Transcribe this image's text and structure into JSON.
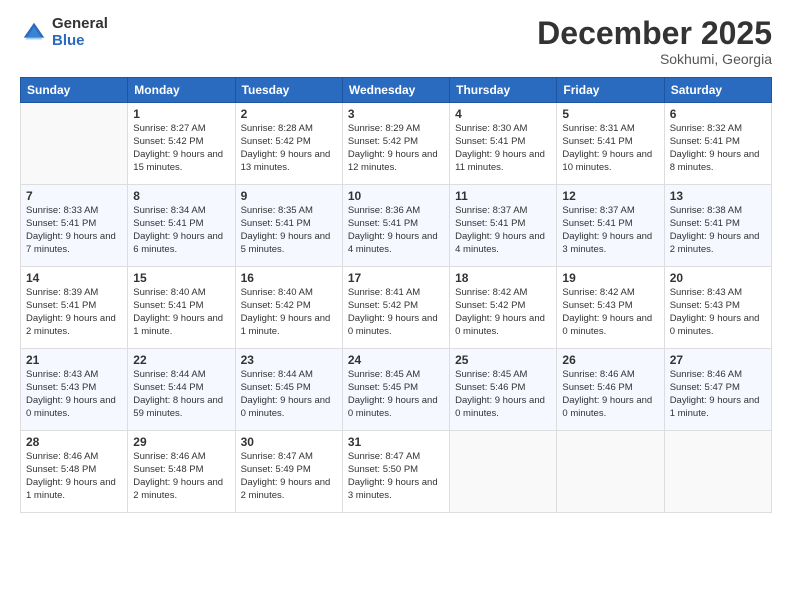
{
  "logo": {
    "general": "General",
    "blue": "Blue"
  },
  "title": "December 2025",
  "location": "Sokhumi, Georgia",
  "weekdays": [
    "Sunday",
    "Monday",
    "Tuesday",
    "Wednesday",
    "Thursday",
    "Friday",
    "Saturday"
  ],
  "weeks": [
    [
      {
        "day": "",
        "sunrise": "",
        "sunset": "",
        "daylight": "",
        "empty": true
      },
      {
        "day": "1",
        "sunrise": "Sunrise: 8:27 AM",
        "sunset": "Sunset: 5:42 PM",
        "daylight": "Daylight: 9 hours and 15 minutes."
      },
      {
        "day": "2",
        "sunrise": "Sunrise: 8:28 AM",
        "sunset": "Sunset: 5:42 PM",
        "daylight": "Daylight: 9 hours and 13 minutes."
      },
      {
        "day": "3",
        "sunrise": "Sunrise: 8:29 AM",
        "sunset": "Sunset: 5:42 PM",
        "daylight": "Daylight: 9 hours and 12 minutes."
      },
      {
        "day": "4",
        "sunrise": "Sunrise: 8:30 AM",
        "sunset": "Sunset: 5:41 PM",
        "daylight": "Daylight: 9 hours and 11 minutes."
      },
      {
        "day": "5",
        "sunrise": "Sunrise: 8:31 AM",
        "sunset": "Sunset: 5:41 PM",
        "daylight": "Daylight: 9 hours and 10 minutes."
      },
      {
        "day": "6",
        "sunrise": "Sunrise: 8:32 AM",
        "sunset": "Sunset: 5:41 PM",
        "daylight": "Daylight: 9 hours and 8 minutes."
      }
    ],
    [
      {
        "day": "7",
        "sunrise": "Sunrise: 8:33 AM",
        "sunset": "Sunset: 5:41 PM",
        "daylight": "Daylight: 9 hours and 7 minutes."
      },
      {
        "day": "8",
        "sunrise": "Sunrise: 8:34 AM",
        "sunset": "Sunset: 5:41 PM",
        "daylight": "Daylight: 9 hours and 6 minutes."
      },
      {
        "day": "9",
        "sunrise": "Sunrise: 8:35 AM",
        "sunset": "Sunset: 5:41 PM",
        "daylight": "Daylight: 9 hours and 5 minutes."
      },
      {
        "day": "10",
        "sunrise": "Sunrise: 8:36 AM",
        "sunset": "Sunset: 5:41 PM",
        "daylight": "Daylight: 9 hours and 4 minutes."
      },
      {
        "day": "11",
        "sunrise": "Sunrise: 8:37 AM",
        "sunset": "Sunset: 5:41 PM",
        "daylight": "Daylight: 9 hours and 4 minutes."
      },
      {
        "day": "12",
        "sunrise": "Sunrise: 8:37 AM",
        "sunset": "Sunset: 5:41 PM",
        "daylight": "Daylight: 9 hours and 3 minutes."
      },
      {
        "day": "13",
        "sunrise": "Sunrise: 8:38 AM",
        "sunset": "Sunset: 5:41 PM",
        "daylight": "Daylight: 9 hours and 2 minutes."
      }
    ],
    [
      {
        "day": "14",
        "sunrise": "Sunrise: 8:39 AM",
        "sunset": "Sunset: 5:41 PM",
        "daylight": "Daylight: 9 hours and 2 minutes."
      },
      {
        "day": "15",
        "sunrise": "Sunrise: 8:40 AM",
        "sunset": "Sunset: 5:41 PM",
        "daylight": "Daylight: 9 hours and 1 minute."
      },
      {
        "day": "16",
        "sunrise": "Sunrise: 8:40 AM",
        "sunset": "Sunset: 5:42 PM",
        "daylight": "Daylight: 9 hours and 1 minute."
      },
      {
        "day": "17",
        "sunrise": "Sunrise: 8:41 AM",
        "sunset": "Sunset: 5:42 PM",
        "daylight": "Daylight: 9 hours and 0 minutes."
      },
      {
        "day": "18",
        "sunrise": "Sunrise: 8:42 AM",
        "sunset": "Sunset: 5:42 PM",
        "daylight": "Daylight: 9 hours and 0 minutes."
      },
      {
        "day": "19",
        "sunrise": "Sunrise: 8:42 AM",
        "sunset": "Sunset: 5:43 PM",
        "daylight": "Daylight: 9 hours and 0 minutes."
      },
      {
        "day": "20",
        "sunrise": "Sunrise: 8:43 AM",
        "sunset": "Sunset: 5:43 PM",
        "daylight": "Daylight: 9 hours and 0 minutes."
      }
    ],
    [
      {
        "day": "21",
        "sunrise": "Sunrise: 8:43 AM",
        "sunset": "Sunset: 5:43 PM",
        "daylight": "Daylight: 9 hours and 0 minutes."
      },
      {
        "day": "22",
        "sunrise": "Sunrise: 8:44 AM",
        "sunset": "Sunset: 5:44 PM",
        "daylight": "Daylight: 8 hours and 59 minutes."
      },
      {
        "day": "23",
        "sunrise": "Sunrise: 8:44 AM",
        "sunset": "Sunset: 5:45 PM",
        "daylight": "Daylight: 9 hours and 0 minutes."
      },
      {
        "day": "24",
        "sunrise": "Sunrise: 8:45 AM",
        "sunset": "Sunset: 5:45 PM",
        "daylight": "Daylight: 9 hours and 0 minutes."
      },
      {
        "day": "25",
        "sunrise": "Sunrise: 8:45 AM",
        "sunset": "Sunset: 5:46 PM",
        "daylight": "Daylight: 9 hours and 0 minutes."
      },
      {
        "day": "26",
        "sunrise": "Sunrise: 8:46 AM",
        "sunset": "Sunset: 5:46 PM",
        "daylight": "Daylight: 9 hours and 0 minutes."
      },
      {
        "day": "27",
        "sunrise": "Sunrise: 8:46 AM",
        "sunset": "Sunset: 5:47 PM",
        "daylight": "Daylight: 9 hours and 1 minute."
      }
    ],
    [
      {
        "day": "28",
        "sunrise": "Sunrise: 8:46 AM",
        "sunset": "Sunset: 5:48 PM",
        "daylight": "Daylight: 9 hours and 1 minute."
      },
      {
        "day": "29",
        "sunrise": "Sunrise: 8:46 AM",
        "sunset": "Sunset: 5:48 PM",
        "daylight": "Daylight: 9 hours and 2 minutes."
      },
      {
        "day": "30",
        "sunrise": "Sunrise: 8:47 AM",
        "sunset": "Sunset: 5:49 PM",
        "daylight": "Daylight: 9 hours and 2 minutes."
      },
      {
        "day": "31",
        "sunrise": "Sunrise: 8:47 AM",
        "sunset": "Sunset: 5:50 PM",
        "daylight": "Daylight: 9 hours and 3 minutes."
      },
      {
        "day": "",
        "sunrise": "",
        "sunset": "",
        "daylight": "",
        "empty": true
      },
      {
        "day": "",
        "sunrise": "",
        "sunset": "",
        "daylight": "",
        "empty": true
      },
      {
        "day": "",
        "sunrise": "",
        "sunset": "",
        "daylight": "",
        "empty": true
      }
    ]
  ]
}
